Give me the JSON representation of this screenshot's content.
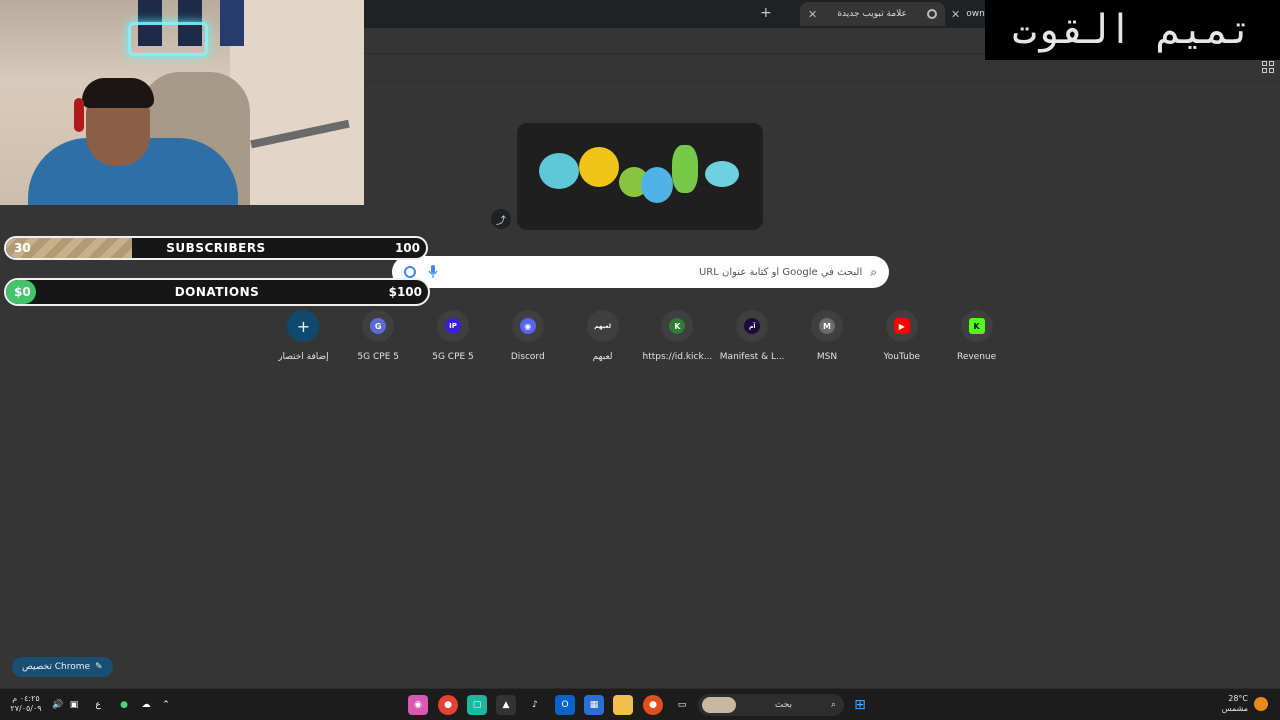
{
  "browser": {
    "tabs": [
      {
        "title": "علامة تبويب جديدة",
        "active": true
      },
      {
        "title": "owns_",
        "active": false
      }
    ],
    "new_tab_symbol": "+",
    "close_symbol": "✕"
  },
  "overlay": {
    "corner_title": "تميم القوت",
    "subscribers": {
      "label": "SUBSCRIBERS",
      "current": "30",
      "goal": "100",
      "progress": 0.3
    },
    "donations": {
      "label": "DONATIONS",
      "current": "$0",
      "goal": "$100",
      "progress": 0.0
    }
  },
  "search": {
    "placeholder": "البحث في Google أو كتابة عنوان URL"
  },
  "shortcuts": [
    {
      "label": "Revenue",
      "icon": "kick-icon",
      "glyph": "K",
      "color": "#53fc18",
      "glyph_color": "#000000"
    },
    {
      "label": "YouTube",
      "icon": "youtube-icon",
      "glyph": "▶",
      "color": "#ff0000",
      "glyph_color": "#ffffff"
    },
    {
      "label": "MSN",
      "icon": "msn-icon",
      "glyph": "M",
      "color": "#6b6b6b",
      "glyph_color": "#ffffff"
    },
    {
      "label": "Manifest & L...",
      "icon": "manifest-icon",
      "glyph": "آم",
      "color": "#1e0a3c",
      "glyph_color": "#ffffff"
    },
    {
      "label": "https://id.kick...",
      "icon": "kick-id-icon",
      "glyph": "K",
      "color": "#2e7d32",
      "glyph_color": "#ffffff"
    },
    {
      "label": "لعبهم",
      "icon": "laabhum-icon",
      "glyph": "لعبهم",
      "color": "#3f3f3f",
      "glyph_color": "#ffffff"
    },
    {
      "label": "Discord",
      "icon": "discord-icon",
      "glyph": "◉",
      "color": "#5865f2",
      "glyph_color": "#ffffff"
    },
    {
      "label": "5G CPE 5",
      "icon": "ip-icon",
      "glyph": "IP",
      "color": "#3b1fd1",
      "glyph_color": "#ffffff"
    },
    {
      "label": "5G CPE 5",
      "icon": "g-icon",
      "glyph": "G",
      "color": "#5b6bd6",
      "glyph_color": "#ffffff"
    }
  ],
  "add_shortcut": {
    "label": "إضافة اختصار",
    "glyph": "+"
  },
  "customize": {
    "label": "تخصيص Chrome",
    "icon": "pencil-icon"
  },
  "taskbar": {
    "search_label": "بحث",
    "weather_temp": "28°C",
    "weather_desc": "مشمس",
    "time": "٠٤:٢٥ م",
    "date": "٢٧/٠٥/٠٩",
    "lang": "ع"
  }
}
